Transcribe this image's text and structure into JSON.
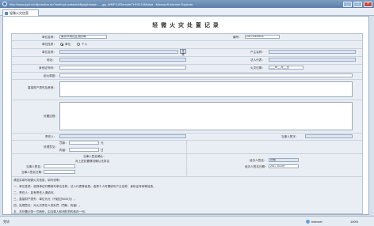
{
  "window": {
    "title": "http://www.jcpt.cn/zfjc/action.do?method=pekeddvBysjdbrkeyt=..._gg_WMFX1IRemoteTHH1110Mdata - Microsoft Internet Explorer",
    "tab": "轻微火灾信息",
    "btn_min": "_",
    "btn_max": "□",
    "btn_close": "×"
  },
  "form": {
    "title": "轻 微 火 灾 处 置 记 录",
    "unit_label": "单位名称：",
    "unit_value": "南京市雨花区消防局",
    "serial_label": "编号：",
    "serial_value": "20170309103",
    "prop_label": "单位性质：",
    "prop_opt1": "单位",
    "prop_opt2": "个人",
    "unitname_label": "单位名称：",
    "select_btn": "选择",
    "owner_label": "户主名称：",
    "address_label": "地址：",
    "legal_label": "法人代表：",
    "phone_label": "电话：",
    "idcard_label": "身份证号码：",
    "fire_time_label": "火灾日期：",
    "fire_time_value": "___年__月__日",
    "cause_label": "起火原因：",
    "area_label": "过火面积：",
    "loss_label": "直接财产损失及其他：",
    "process_label": "处置过程：",
    "responsible_label": "责任人：",
    "responsible_sig_label": "当事人签字：",
    "handle_label": "处理意见：",
    "handle_opt1": "罚款：",
    "handle_opt2": "拘留：",
    "unit_yuan": "元",
    "unit_day": "日",
    "party_title": "当事人签名确认：",
    "party_note": "对上述处置情况确认无异议",
    "party_label1": "当事人签名：",
    "party_label2": "当事人签名日期：",
    "handler_label": "经办人签名：",
    "handler_value": "刘伟",
    "handler_date_label": "经办人签名日期：",
    "handler_date_value": "2017-03-09",
    "notes_head": "请如实填写轻微火灾信息，填写说明：",
    "note1": "一、单位性质：选择单位时需填写单位名称、法人代表等信息；选择个人时需填写户主名称、身份证号码等信息。",
    "note2": "二、责任人：如有责任人请填写。",
    "note3": "三、直接财产损失：单位为元（不超过5000元）。",
    "note4": "四、处理意见：对火灾责任人的处罚（罚款、拘留）。",
    "note5": "五、本处置记录一式两份，由当事人和消防机构各存一份。"
  },
  "status": {
    "done": "完毕",
    "zone": "Internet",
    "zoom": "100%"
  },
  "colors": {
    "titlebar": "#5d7fa8",
    "frame_bg": "#e9eef4",
    "field_highlight": "#dce6f4"
  }
}
